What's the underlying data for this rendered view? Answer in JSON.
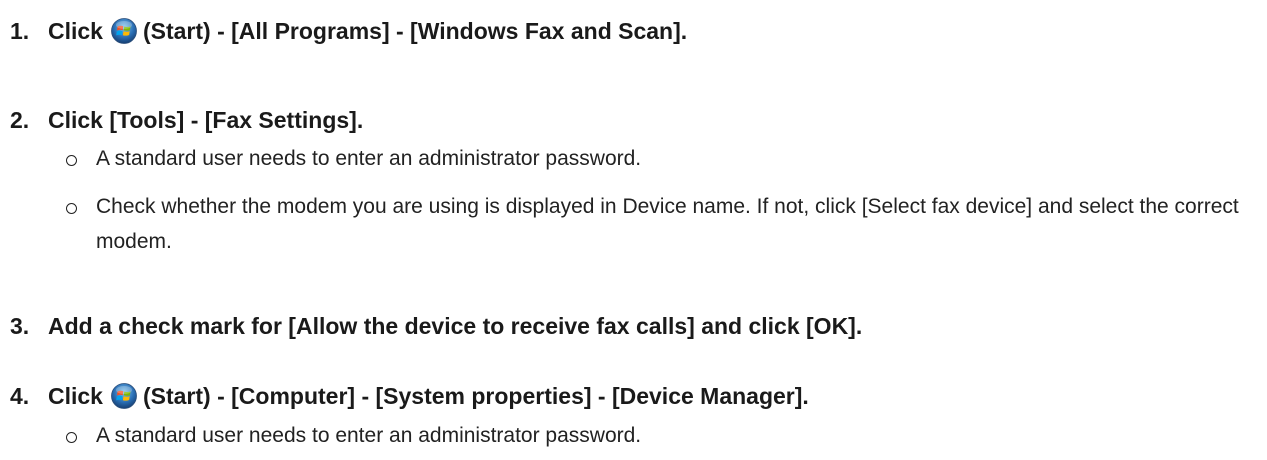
{
  "steps": [
    {
      "number": "1.",
      "prefix": "Click",
      "suffix": "(Start) - [All Programs] - [Windows Fax and Scan]."
    },
    {
      "number": "2.",
      "text": "Click [Tools] - [Fax Settings].",
      "bullets": [
        "A standard user needs to enter an administrator password.",
        "Check whether the modem you are using is displayed in Device name. If not, click [Select fax device] and select the correct modem."
      ]
    },
    {
      "number": "3.",
      "text": "Add a check mark for [Allow the device to receive fax calls] and click [OK]."
    },
    {
      "number": "4.",
      "prefix": "Click",
      "suffix": "(Start) - [Computer] - [System properties] - [Device Manager].",
      "bullets": [
        "A standard user needs to enter an administrator password."
      ]
    }
  ],
  "icons": {
    "start": "windows-start-orb-icon"
  }
}
